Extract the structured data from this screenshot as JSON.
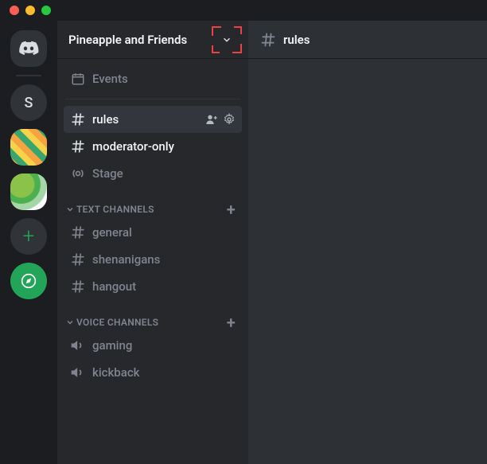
{
  "server_name": "Pineapple and Friends",
  "servers": {
    "letter": "S"
  },
  "events_label": "Events",
  "top_channels": [
    {
      "name": "rules",
      "type": "hash",
      "selected": true
    },
    {
      "name": "moderator-only",
      "type": "hash",
      "selected": false,
      "unread": true
    },
    {
      "name": "Stage",
      "type": "stage",
      "selected": false
    }
  ],
  "categories": [
    {
      "label": "TEXT CHANNELS",
      "channels": [
        {
          "name": "general",
          "type": "hash"
        },
        {
          "name": "shenanigans",
          "type": "hash"
        },
        {
          "name": "hangout",
          "type": "hash"
        }
      ]
    },
    {
      "label": "VOICE CHANNELS",
      "channels": [
        {
          "name": "gaming",
          "type": "voice"
        },
        {
          "name": "kickback",
          "type": "voice"
        }
      ]
    }
  ],
  "main_channel": "rules"
}
